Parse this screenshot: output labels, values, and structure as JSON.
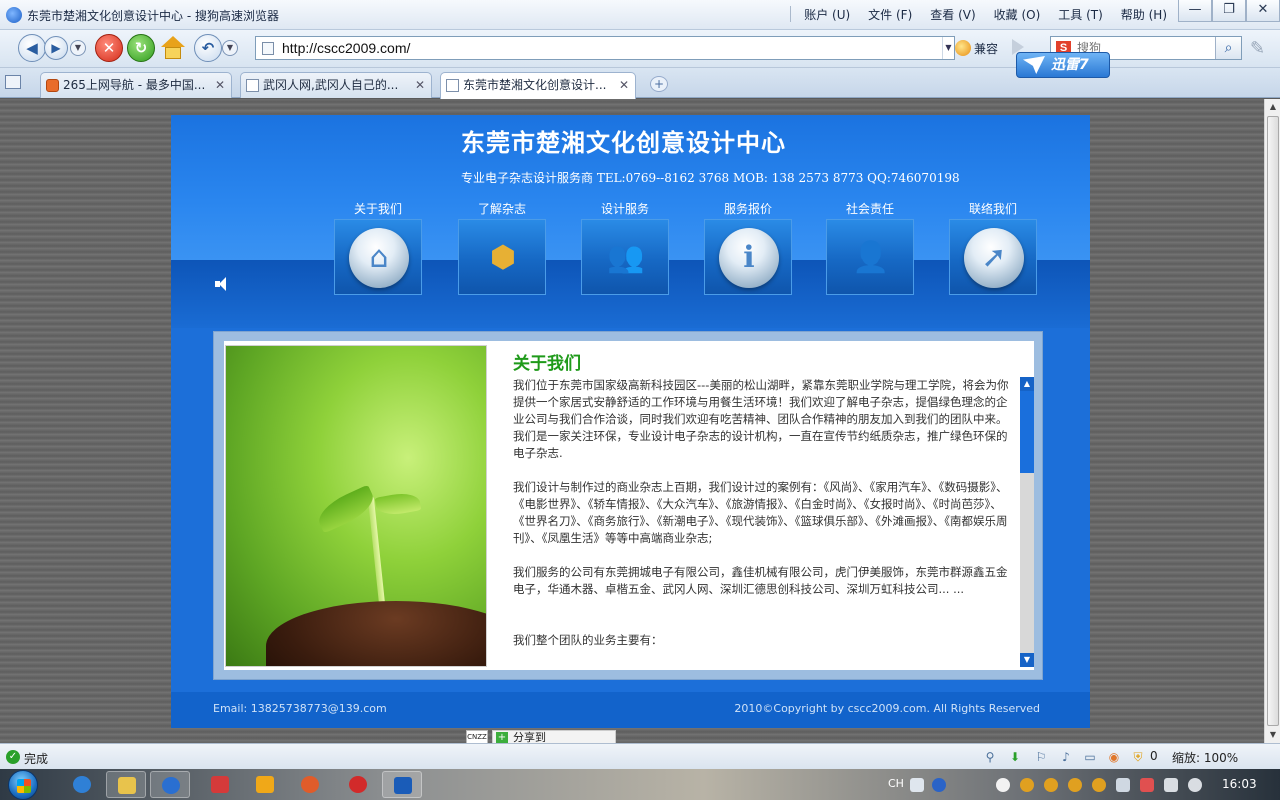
{
  "window": {
    "title": "东莞市楚湘文化创意设计中心 - 搜狗高速浏览器"
  },
  "menu": [
    "账户 (U)",
    "文件 (F)",
    "查看 (V)",
    "收藏 (O)",
    "工具 (T)",
    "帮助 (H)"
  ],
  "window_controls": {
    "minimize": "—",
    "maximize": "❐",
    "close": "✕"
  },
  "toolbar": {
    "url": "http://cscc2009.com/",
    "compat_label": "兼容",
    "search_placeholder": "搜狗"
  },
  "tabs": [
    {
      "label": "265上网导航 - 最多中国...",
      "active": false
    },
    {
      "label": "武冈人网,武冈人自己的...",
      "active": false
    },
    {
      "label": "东莞市楚湘文化创意设计...",
      "active": true
    }
  ],
  "xunlei_label": "迅雷7",
  "site": {
    "title": "东莞市楚湘文化创意设计中心",
    "contact": "专业电子杂志设计服务商   TEL:0769--8162 3768      MOB: 138 2573 8773      QQ:746070198",
    "nav": [
      {
        "label": "关于我们",
        "icon": "home-icon"
      },
      {
        "label": "了解杂志",
        "icon": "box-disc-icon"
      },
      {
        "label": "设计服务",
        "icon": "users-icon"
      },
      {
        "label": "服务报价",
        "icon": "info-icon"
      },
      {
        "label": "社会责任",
        "icon": "person-icon"
      },
      {
        "label": "联络我们",
        "icon": "cursor-icon"
      }
    ],
    "article": {
      "title": "关于我们",
      "paragraphs": [
        "我们位于东莞市国家级高新科技园区---美丽的松山湖畔，紧靠东莞职业学院与理工学院，将会为你提供一个家居式安静舒适的工作环境与用餐生活环境！我们欢迎了解电子杂志，提倡绿色理念的企业公司与我们合作洽谈，同时我们欢迎有吃苦精神、团队合作精神的朋友加入到我们的团队中来。我们是一家关注环保，专业设计电子杂志的设计机构，一直在宣传节约纸质杂志，推广绿色环保的电子杂志.",
        "我们设计与制作过的商业杂志上百期，我们设计过的案例有：《风尚》、《家用汽车》、《数码摄影》、《电影世界》、《轿车情报》、《大众汽车》、《旅游情报》、《白金时尚》、《女报时尚》、《时尚芭莎》、《世界名刀》、《商务旅行》、《新潮电子》、《现代装饰》、《篮球俱乐部》、《外滩画报》、《南都娱乐周刊》、《凤凰生活》等等中高端商业杂志;",
        "我们服务的公司有东莞拥城电子有限公司，鑫佳机械有限公司，虎门伊美服饰，东莞市群源鑫五金电子，华通木器、卓楷五金、武冈人网、深圳汇德思创科技公司、深圳万虹科技公司... ...",
        "我们整个团队的业务主要有："
      ]
    },
    "footer": {
      "email": "Email: 13825738773@139.com",
      "copyright": "2010©Copyright by cscc2009.com. All Rights Reserved"
    },
    "share_label": "分享到"
  },
  "statusbar": {
    "status": "完成",
    "count": "0",
    "zoom": "缩放: 100%"
  },
  "taskbar": {
    "ime": "CH",
    "clock": "16:03"
  },
  "colors": {
    "site_blue": "#1c6fd9",
    "article_title_green": "#1f9a1a"
  }
}
